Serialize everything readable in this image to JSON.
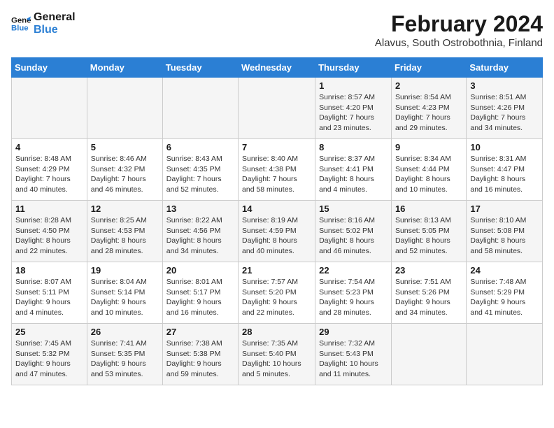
{
  "logo": {
    "line1": "General",
    "line2": "Blue"
  },
  "title": {
    "month_year": "February 2024",
    "location": "Alavus, South Ostrobothnia, Finland"
  },
  "days_of_week": [
    "Sunday",
    "Monday",
    "Tuesday",
    "Wednesday",
    "Thursday",
    "Friday",
    "Saturday"
  ],
  "weeks": [
    [
      {
        "num": "",
        "info": ""
      },
      {
        "num": "",
        "info": ""
      },
      {
        "num": "",
        "info": ""
      },
      {
        "num": "",
        "info": ""
      },
      {
        "num": "1",
        "info": "Sunrise: 8:57 AM\nSunset: 4:20 PM\nDaylight: 7 hours\nand 23 minutes."
      },
      {
        "num": "2",
        "info": "Sunrise: 8:54 AM\nSunset: 4:23 PM\nDaylight: 7 hours\nand 29 minutes."
      },
      {
        "num": "3",
        "info": "Sunrise: 8:51 AM\nSunset: 4:26 PM\nDaylight: 7 hours\nand 34 minutes."
      }
    ],
    [
      {
        "num": "4",
        "info": "Sunrise: 8:48 AM\nSunset: 4:29 PM\nDaylight: 7 hours\nand 40 minutes."
      },
      {
        "num": "5",
        "info": "Sunrise: 8:46 AM\nSunset: 4:32 PM\nDaylight: 7 hours\nand 46 minutes."
      },
      {
        "num": "6",
        "info": "Sunrise: 8:43 AM\nSunset: 4:35 PM\nDaylight: 7 hours\nand 52 minutes."
      },
      {
        "num": "7",
        "info": "Sunrise: 8:40 AM\nSunset: 4:38 PM\nDaylight: 7 hours\nand 58 minutes."
      },
      {
        "num": "8",
        "info": "Sunrise: 8:37 AM\nSunset: 4:41 PM\nDaylight: 8 hours\nand 4 minutes."
      },
      {
        "num": "9",
        "info": "Sunrise: 8:34 AM\nSunset: 4:44 PM\nDaylight: 8 hours\nand 10 minutes."
      },
      {
        "num": "10",
        "info": "Sunrise: 8:31 AM\nSunset: 4:47 PM\nDaylight: 8 hours\nand 16 minutes."
      }
    ],
    [
      {
        "num": "11",
        "info": "Sunrise: 8:28 AM\nSunset: 4:50 PM\nDaylight: 8 hours\nand 22 minutes."
      },
      {
        "num": "12",
        "info": "Sunrise: 8:25 AM\nSunset: 4:53 PM\nDaylight: 8 hours\nand 28 minutes."
      },
      {
        "num": "13",
        "info": "Sunrise: 8:22 AM\nSunset: 4:56 PM\nDaylight: 8 hours\nand 34 minutes."
      },
      {
        "num": "14",
        "info": "Sunrise: 8:19 AM\nSunset: 4:59 PM\nDaylight: 8 hours\nand 40 minutes."
      },
      {
        "num": "15",
        "info": "Sunrise: 8:16 AM\nSunset: 5:02 PM\nDaylight: 8 hours\nand 46 minutes."
      },
      {
        "num": "16",
        "info": "Sunrise: 8:13 AM\nSunset: 5:05 PM\nDaylight: 8 hours\nand 52 minutes."
      },
      {
        "num": "17",
        "info": "Sunrise: 8:10 AM\nSunset: 5:08 PM\nDaylight: 8 hours\nand 58 minutes."
      }
    ],
    [
      {
        "num": "18",
        "info": "Sunrise: 8:07 AM\nSunset: 5:11 PM\nDaylight: 9 hours\nand 4 minutes."
      },
      {
        "num": "19",
        "info": "Sunrise: 8:04 AM\nSunset: 5:14 PM\nDaylight: 9 hours\nand 10 minutes."
      },
      {
        "num": "20",
        "info": "Sunrise: 8:01 AM\nSunset: 5:17 PM\nDaylight: 9 hours\nand 16 minutes."
      },
      {
        "num": "21",
        "info": "Sunrise: 7:57 AM\nSunset: 5:20 PM\nDaylight: 9 hours\nand 22 minutes."
      },
      {
        "num": "22",
        "info": "Sunrise: 7:54 AM\nSunset: 5:23 PM\nDaylight: 9 hours\nand 28 minutes."
      },
      {
        "num": "23",
        "info": "Sunrise: 7:51 AM\nSunset: 5:26 PM\nDaylight: 9 hours\nand 34 minutes."
      },
      {
        "num": "24",
        "info": "Sunrise: 7:48 AM\nSunset: 5:29 PM\nDaylight: 9 hours\nand 41 minutes."
      }
    ],
    [
      {
        "num": "25",
        "info": "Sunrise: 7:45 AM\nSunset: 5:32 PM\nDaylight: 9 hours\nand 47 minutes."
      },
      {
        "num": "26",
        "info": "Sunrise: 7:41 AM\nSunset: 5:35 PM\nDaylight: 9 hours\nand 53 minutes."
      },
      {
        "num": "27",
        "info": "Sunrise: 7:38 AM\nSunset: 5:38 PM\nDaylight: 9 hours\nand 59 minutes."
      },
      {
        "num": "28",
        "info": "Sunrise: 7:35 AM\nSunset: 5:40 PM\nDaylight: 10 hours\nand 5 minutes."
      },
      {
        "num": "29",
        "info": "Sunrise: 7:32 AM\nSunset: 5:43 PM\nDaylight: 10 hours\nand 11 minutes."
      },
      {
        "num": "",
        "info": ""
      },
      {
        "num": "",
        "info": ""
      }
    ]
  ]
}
